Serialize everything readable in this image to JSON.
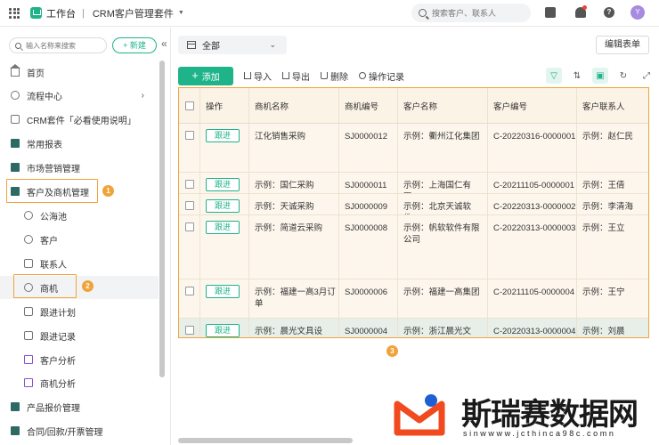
{
  "topbar": {
    "app_name": "工作台",
    "separator": "|",
    "crm_title": "CRM客户管理套件",
    "search_placeholder": "搜索客户、联系人",
    "avatar_letter": "Y"
  },
  "sidebar": {
    "search_placeholder": "输入名称来搜索",
    "new_label": "+ 新建",
    "collapse_glyph": "«",
    "items": [
      {
        "label": "首页",
        "icon": "home-icon"
      },
      {
        "label": "流程中心",
        "icon": "flow-icon"
      },
      {
        "label": "CRM套件「必看使用说明」",
        "icon": "doc-icon"
      },
      {
        "label": "常用报表",
        "icon": "folder-icon"
      },
      {
        "label": "市场营销管理",
        "icon": "folder-icon"
      },
      {
        "label": "客户及商机管理",
        "icon": "folder-open-icon"
      },
      {
        "label": "公海池",
        "icon": "people-icon"
      },
      {
        "label": "客户",
        "icon": "user-icon"
      },
      {
        "label": "联系人",
        "icon": "contact-icon"
      },
      {
        "label": "商机",
        "icon": "target-icon"
      },
      {
        "label": "跟进计划",
        "icon": "calendar-icon"
      },
      {
        "label": "跟进记录",
        "icon": "record-icon"
      },
      {
        "label": "客户分析",
        "icon": "chart-screen-icon"
      },
      {
        "label": "商机分析",
        "icon": "chart-screen-icon"
      },
      {
        "label": "产品报价管理",
        "icon": "folder-icon"
      },
      {
        "label": "合同/回款/开票管理",
        "icon": "folder-icon"
      }
    ],
    "markers": [
      "1",
      "2"
    ]
  },
  "main": {
    "view_label": "全部",
    "edit_form_label": "编辑表单",
    "toolbar": {
      "add_label": "添加",
      "import_label": "导入",
      "export_label": "导出",
      "delete_label": "删除",
      "log_label": "操作记录"
    },
    "table_marker": "3",
    "columns": [
      "操作",
      "商机名称",
      "商机编号",
      "客户名称",
      "客户编号",
      "客户联系人"
    ],
    "rows": [
      {
        "action": "跟进",
        "name": "江化销售采购",
        "code": "SJ0000012",
        "customer": "示例：衢州江化集团",
        "customer_code": "C-20220316-0000001",
        "contact": "示例：赵仁民"
      },
      {
        "action": "跟进",
        "name": "示例：国仁采购",
        "code": "SJ0000011",
        "customer": "示例：上海国仁有限…",
        "customer_code": "C-20211105-0000001",
        "contact": "示例：王倩"
      },
      {
        "action": "跟进",
        "name": "示例：天诚采购",
        "code": "SJ0000009",
        "customer": "示例：北京天诚软件…",
        "customer_code": "C-20220313-0000002",
        "contact": "示例：李清海"
      },
      {
        "action": "跟进",
        "name": "示例：简道云采购",
        "code": "SJ0000008",
        "customer": "示例：帆软软件有限公司",
        "customer_code": "C-20220313-0000003",
        "contact": "示例：王立"
      },
      {
        "action": "跟进",
        "name": "示例：福建一高3月订单",
        "code": "SJ0000006",
        "customer": "示例：福建一高集团",
        "customer_code": "C-20211105-0000004",
        "contact": "示例：王宁"
      },
      {
        "action": "跟进",
        "name": "示例：晨光文具设备…",
        "code": "SJ0000004",
        "customer": "示例：浙江晨光文具…",
        "customer_code": "C-20220313-0000004",
        "contact": "示例：刘晨"
      }
    ]
  },
  "watermark": {
    "text": "斯瑞赛数据网",
    "url": "sinwwww.jcthinca98c.comn"
  },
  "colors": {
    "accent": "#1fb38a",
    "highlight": "#f0a33a",
    "sidebar_folder": "#2d6a64"
  }
}
